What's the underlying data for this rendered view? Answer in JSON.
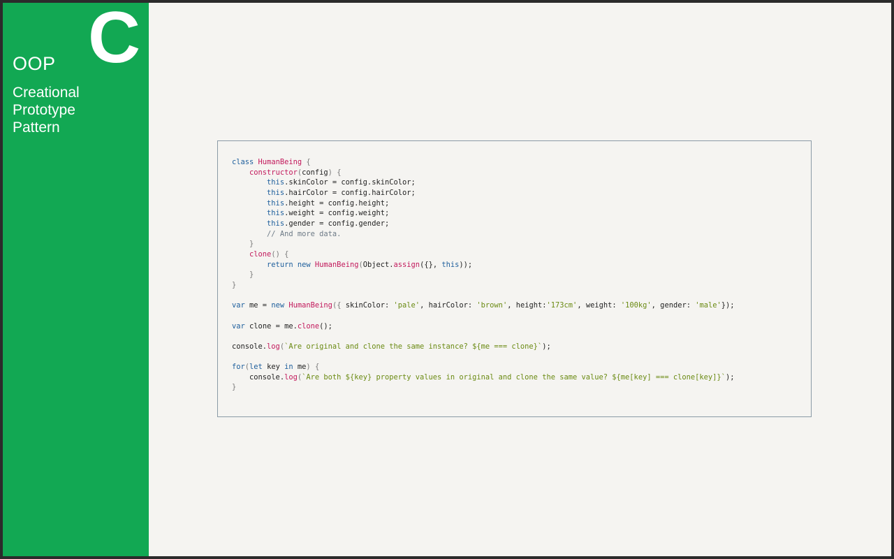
{
  "sidebar": {
    "big_letter": "C",
    "section": "OOP",
    "subtitle_lines": [
      "Creational",
      "Prototype",
      "Pattern"
    ]
  },
  "code": {
    "language": "javascript",
    "lines": [
      "class HumanBeing {",
      "    constructor(config) {",
      "        this.skinColor = config.skinColor;",
      "        this.hairColor = config.hairColor;",
      "        this.height = config.height;",
      "        this.weight = config.weight;",
      "        this.gender = config.gender;",
      "        // And more data.",
      "    }",
      "    clone() {",
      "        return new HumanBeing(Object.assign({}, this));",
      "    }",
      "}",
      "",
      "var me = new HumanBeing({ skinColor: 'pale', hairColor: 'brown', height:'173cm', weight: '100kg', gender: 'male'});",
      "",
      "var clone = me.clone();",
      "",
      "console.log(`Are original and clone the same instance? ${me === clone}`);",
      "",
      "for(let key in me) {",
      "    console.log(`Are both ${key} property values in original and clone the same value? ${me[key] === clone[key]}`);",
      "}"
    ]
  },
  "colors": {
    "sidebar": "#12a853",
    "background": "#f5f4f1",
    "keyword": "#1d5e9c",
    "function": "#c2185b",
    "string": "#6a8a12",
    "comment": "#6d7a86"
  }
}
